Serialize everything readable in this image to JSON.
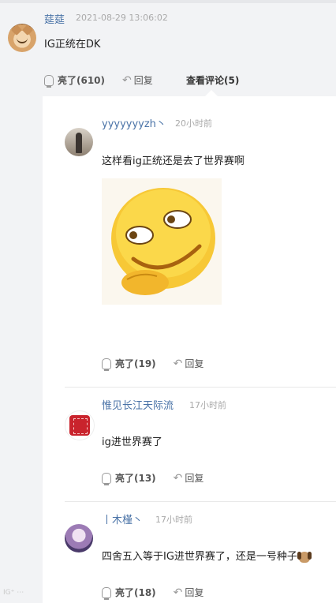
{
  "parent_comment": {
    "username": "莚莚",
    "time": "2021-08-29 13:06:02",
    "text": "IG正统在DK",
    "like_label": "亮了(610)",
    "reply_label": "回复",
    "view_comments_label": "查看评论(5)"
  },
  "replies": [
    {
      "username": "yyyyyyyzh丶",
      "time": "20小时前",
      "text": "这样看ig正统还是去了世界赛啊",
      "has_sticker": true,
      "like_label": "亮了(19)",
      "reply_label": "回复"
    },
    {
      "username": "惟见长江天际流",
      "time": "17小时前",
      "text": "ig进世界赛了",
      "like_label": "亮了(13)",
      "reply_label": "回复"
    },
    {
      "username": "丨木槿丶",
      "time": "17小时前",
      "text": "四舍五入等于IG进世界赛了，还是一号种子",
      "trailing_emoji": "dog-emoji",
      "like_label": "亮了(18)",
      "reply_label": "回复"
    }
  ],
  "icons": {
    "like": "lightbulb-icon",
    "reply": "reply-arrow-icon"
  },
  "colors": {
    "username": "#4a73a7",
    "timestamp": "#aaaaaa",
    "page_bg": "#f2f3f5",
    "panel_bg": "#ffffff"
  }
}
